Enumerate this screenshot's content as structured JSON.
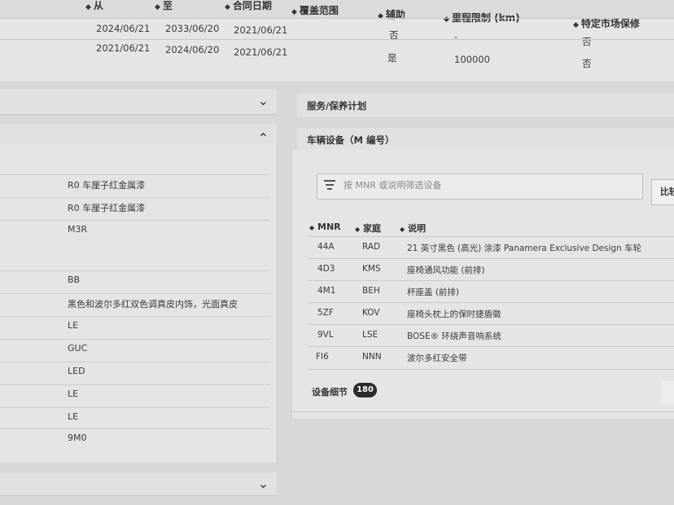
{
  "warranty_table": {
    "headers": {
      "from": "从",
      "to": "至",
      "contract_date": "合同日期",
      "coverage": "覆盖范围",
      "auxiliary": "辅助",
      "mileage_limit": "里程限制 (km)",
      "market_specific": "特定市场保修"
    },
    "rows": [
      {
        "from": "2024/06/21",
        "to": "2033/06/20",
        "contract_date": "2021/06/21",
        "coverage": "",
        "auxiliary": "否",
        "mileage_limit": "-",
        "market_specific": "否"
      },
      {
        "from": "2021/06/21",
        "to": "2024/06/20",
        "contract_date": "2021/06/21",
        "coverage": "",
        "auxiliary": "是",
        "mileage_limit": "100000",
        "market_specific": "否"
      }
    ]
  },
  "left_panel": {
    "values": [
      "R0 车厘子红金属漆",
      "R0 车厘子红金属漆",
      "M3R",
      "",
      "BB",
      "黑色和波尔多红双色调真皮内饰，光面真皮",
      "LE",
      "GUC",
      "LED",
      "LE",
      "LE",
      "9M0"
    ]
  },
  "right_panel": {
    "service_title": "服务/保养计划",
    "equipment_title": "车辆设备（M 编号）",
    "filter_placeholder": "按 MNR 或说明筛选设备",
    "compare_label": "比较",
    "columns": {
      "mnr": "MNR",
      "family": "家庭",
      "description": "说明"
    },
    "equipment": [
      {
        "mnr": "44A",
        "family": "RAD",
        "description": "21 英寸黑色 (高光) 涂漆 Panamera Exclusive Design 车轮"
      },
      {
        "mnr": "4D3",
        "family": "KMS",
        "description": "座椅通风功能 (前排)"
      },
      {
        "mnr": "4M1",
        "family": "BEH",
        "description": "杯座盖 (前排)"
      },
      {
        "mnr": "5ZF",
        "family": "KOV",
        "description": "座椅头枕上的保时捷盾徽"
      },
      {
        "mnr": "9VL",
        "family": "LSE",
        "description": "BOSE® 环绕声音响系统"
      },
      {
        "mnr": "FI6",
        "family": "NNN",
        "description": "波尔多红安全带"
      }
    ],
    "details_label": "设备细节",
    "details_count": "180"
  },
  "icons": {
    "sort": "sort-icon",
    "chevron_down": "chevron-down-icon",
    "chevron_up": "chevron-up-icon",
    "filter": "filter-icon"
  }
}
